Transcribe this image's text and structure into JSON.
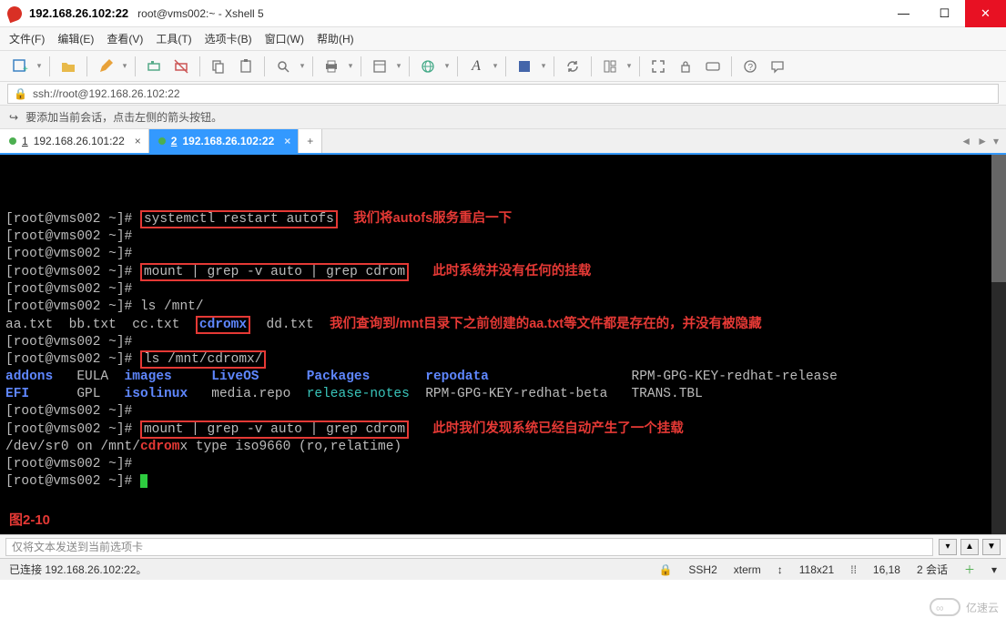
{
  "window": {
    "title_host": "192.168.26.102:22",
    "title_suffix": "root@vms002:~ - Xshell 5"
  },
  "menus": {
    "file": "文件(F)",
    "edit": "编辑(E)",
    "view": "查看(V)",
    "tools": "工具(T)",
    "tabs": "选项卡(B)",
    "window": "窗口(W)",
    "help": "帮助(H)"
  },
  "toolbar_icons": {
    "new_session": "new-session-icon",
    "open": "open-icon",
    "pencil": "pencil-icon",
    "connect": "connect-icon",
    "disconnect": "disconnect-icon",
    "copy": "copy-icon",
    "paste": "paste-icon",
    "find": "find-icon",
    "print": "print-icon",
    "properties": "properties-icon",
    "globe": "globe-icon",
    "font": "font-icon",
    "color": "color-icon",
    "sync": "sync-icon",
    "layout": "layout-icon",
    "fullscreen": "fullscreen-icon",
    "lock": "lock-icon",
    "keyboard": "keyboard-icon",
    "help": "help-icon",
    "chat": "chat-icon"
  },
  "address_bar": {
    "url": "ssh://root@192.168.26.102:22"
  },
  "hint_bar": {
    "text": "要添加当前会话，点击左侧的箭头按钮。"
  },
  "tabs": {
    "tab1": {
      "index": "1",
      "label": "192.168.26.101:22"
    },
    "tab2": {
      "index": "2",
      "label": "192.168.26.102:22"
    },
    "add": "+"
  },
  "terminal": {
    "prompt": "[root@vms002 ~]# ",
    "lines": {
      "l1_cmd": "systemctl restart autofs",
      "l1_annot": "我们将autofs服务重启一下",
      "l4_cmd": "mount | grep -v auto | grep cdrom",
      "l4_annot": "此时系统并没有任何的挂载",
      "l6_cmd": "ls /mnt/",
      "l7_files": {
        "f1": "aa.txt",
        "f2": "bb.txt",
        "f3": "cc.txt",
        "f4": "cdromx",
        "f5": "dd.txt"
      },
      "l7_annot": "我们查询到/mnt目录下之前创建的aa.txt等文件都是存在的，并没有被隐藏",
      "l9_cmd": "ls /mnt/cdromx/",
      "ls_out": {
        "r1c1": "addons",
        "r1c2": "EULA",
        "r1c3": "images",
        "r1c4": "LiveOS",
        "r1c5": "Packages",
        "r1c6": "repodata",
        "r1c7": "RPM-GPG-KEY-redhat-release",
        "r2c1": "EFI",
        "r2c2": "GPL",
        "r2c3": "isolinux",
        "r2c4": "media.repo",
        "r2c5": "release-notes",
        "r2c6": "RPM-GPG-KEY-redhat-beta",
        "r2c7": "TRANS.TBL"
      },
      "l12_cmd": "mount | grep -v auto | grep cdrom",
      "l12_annot": "此时我们发现系统已经自动产生了一个挂载",
      "l13_pre": "/dev/sr0 on /mnt/",
      "l13_match": "cdrom",
      "l13_post": "x type iso9660 (ro,relatime)"
    },
    "figure_label": "图2-10"
  },
  "sendbar": {
    "placeholder": "仅将文本发送到当前选项卡"
  },
  "statusbar": {
    "connection": "已连接 192.168.26.102:22。",
    "protocol": "SSH2",
    "term": "xterm",
    "size": "118x21",
    "cursor_pos": "16,18",
    "sessions": "2 会话"
  },
  "watermark": {
    "text": "亿速云"
  }
}
